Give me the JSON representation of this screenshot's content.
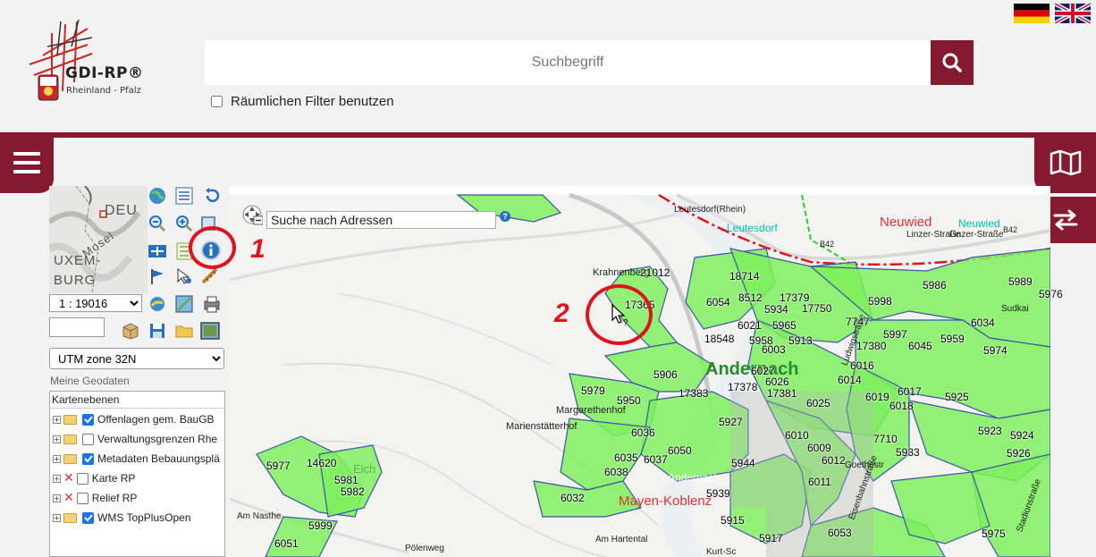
{
  "header": {
    "logo_title": "GDI-RP®",
    "logo_subtitle": "Rheinland - Pfalz",
    "search_placeholder": "Suchbegriff",
    "search_icon": "search-icon",
    "spatial_filter_label": "Räumlichen Filter benutzen",
    "flags": [
      "german-flag-icon",
      "uk-flag-icon"
    ]
  },
  "nav": {
    "menu_icon": "hamburger-menu-icon",
    "map_icon": "map-icon",
    "swap_icon": "swap-arrows-icon"
  },
  "overview_map": {
    "labels": [
      "DEU",
      "Mosel",
      "UXEM-",
      "BURG"
    ]
  },
  "toolbar": {
    "tools": [
      "globe-icon",
      "layer-list-icon",
      "undo-icon",
      "zoom-out-icon",
      "zoom-in-icon",
      "zoom-box-icon",
      "pan-icon",
      "legend-icon",
      "info-icon",
      "flag-icon",
      "select-icon",
      "measure-icon",
      "print-icon",
      "gps-icon",
      "route-icon",
      "package-icon",
      "save-icon",
      "folder-icon",
      "image-icon"
    ]
  },
  "panel": {
    "scale_value": "1 : 19016",
    "crs_value": "UTM zone 32N",
    "geodata_label": "Meine Geodaten",
    "layers_header": "Kartenebenen",
    "layers": [
      {
        "label": "Offenlagen gem. BauGB",
        "checked": true,
        "error": false
      },
      {
        "label": "Verwaltungsgrenzen Rhe",
        "checked": false,
        "error": false
      },
      {
        "label": "Metadaten Bebauungsplä",
        "checked": true,
        "error": false
      },
      {
        "label": "Karte RP",
        "checked": false,
        "error": true
      },
      {
        "label": "Relief RP",
        "checked": false,
        "error": true
      },
      {
        "label": "WMS TopPlusOpen",
        "checked": true,
        "error": false
      }
    ]
  },
  "map": {
    "address_search": "Suche nach Adressen",
    "help": "?",
    "annotations": [
      "1",
      "2"
    ],
    "places": [
      "Leutesdorf(Rhein)",
      "Leutesdorf",
      "Neuwied",
      "Neuwied",
      "Linzer-Straße",
      "Linzer-Straße",
      "B42",
      "B42",
      "Krahnenberg",
      "Andernach",
      "Margarethenhof",
      "Marienstätterhof",
      "Andernach",
      "Mayen-Koblenz",
      "Am Nasthe",
      "Pölenweg",
      "Am Hartental",
      "Kurt-Sc",
      "Eich",
      "Goethestr",
      "Sudkai",
      "Stadionstraße",
      "Ludwigstraße",
      "Eisenbahnstraße"
    ],
    "parcels": [
      "21012",
      "18714",
      "6054",
      "8512",
      "17379",
      "17750",
      "5934",
      "6021",
      "5965",
      "17365",
      "18548",
      "5958",
      "5913",
      "6003",
      "6027",
      "17378",
      "6026",
      "17381",
      "5906",
      "17383",
      "5979",
      "5950",
      "5998",
      "5986",
      "5989",
      "5976",
      "6034",
      "7747",
      "5997",
      "17380",
      "6045",
      "5959",
      "5974",
      "6016",
      "6014",
      "6019",
      "6017",
      "6018",
      "5925",
      "6025",
      "5927",
      "6036",
      "6050",
      "6035",
      "6037",
      "6038",
      "5944",
      "6010",
      "6009",
      "6012",
      "7710",
      "5933",
      "5923",
      "5924",
      "5926",
      "6011",
      "5939",
      "6032",
      "5915",
      "5917",
      "6053",
      "5975",
      "5977",
      "14620",
      "5981",
      "5982",
      "5999",
      "6051"
    ]
  }
}
